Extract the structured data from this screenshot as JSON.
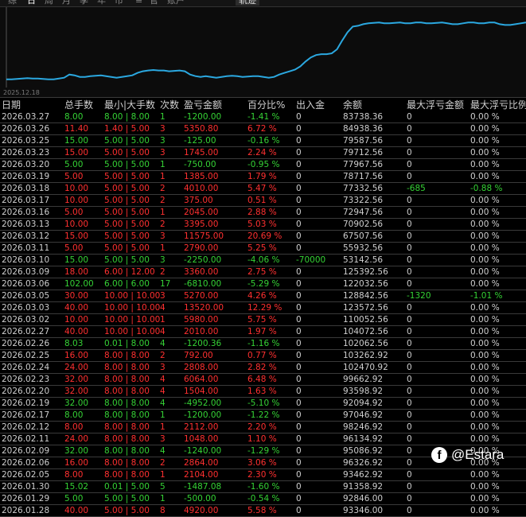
{
  "tabs": [
    {
      "label": "综",
      "active": false
    },
    {
      "label": "日",
      "active": true
    },
    {
      "label": "周",
      "active": false
    },
    {
      "label": "月",
      "active": false
    },
    {
      "label": "季",
      "active": false
    },
    {
      "label": "年",
      "active": false
    },
    {
      "label": "币",
      "active": false
    },
    {
      "label": "≡",
      "active": false
    },
    {
      "label": "官",
      "active": false
    },
    {
      "label": "账户",
      "active": false
    },
    {
      "label": "轨迹",
      "active": false,
      "boxed": true
    }
  ],
  "chart_data": {
    "type": "line",
    "x_start_label": "2025.12.18",
    "values": [
      10,
      10,
      10.5,
      11,
      11.5,
      11,
      11,
      10.5,
      10,
      10,
      11,
      12,
      16,
      15,
      13,
      13,
      14,
      14.5,
      15,
      14,
      13,
      12,
      13,
      14,
      15,
      18,
      20,
      21,
      21.5,
      21,
      21,
      20,
      20.5,
      21,
      20,
      16,
      14,
      13,
      14,
      13,
      12,
      13,
      14,
      14.5,
      14,
      13,
      13.5,
      14,
      14,
      13,
      12,
      13,
      16,
      18,
      20,
      22,
      26,
      32,
      37,
      40,
      41,
      41,
      42,
      47,
      58,
      68,
      75,
      76,
      78,
      79,
      79.5,
      80,
      79,
      79,
      79.5,
      80,
      79,
      79,
      80,
      80,
      79,
      79,
      79.5,
      80,
      79,
      78,
      78,
      79,
      80,
      80,
      79,
      79,
      80,
      80,
      78,
      77,
      77,
      78,
      79,
      80
    ],
    "ylim": [
      0,
      95
    ],
    "color": "#2ba8e0",
    "grid": false
  },
  "table": {
    "headers": [
      "日期",
      "总手数",
      "最小|大手数",
      "次数",
      "盈亏金额",
      "百分比%",
      "出入金",
      "余额",
      "最大浮亏金额",
      "最大浮亏比例"
    ],
    "rows": [
      {
        "date": "2026.03.27",
        "lots": "8.00",
        "minmax": "8.00 | 8.00",
        "count": "1",
        "pnl": "-1200.00",
        "pct": "-1.41 %",
        "flow": "0",
        "balance": "83738.36",
        "maxdd": "0",
        "maxddpct": "0.00 %",
        "sign": "pos"
      },
      {
        "date": "2026.03.26",
        "lots": "11.40",
        "minmax": "1.40 | 5.00",
        "count": "3",
        "pnl": "5350.80",
        "pct": "6.72 %",
        "flow": "0",
        "balance": "84938.36",
        "maxdd": "0",
        "maxddpct": "0.00 %",
        "sign": "neg"
      },
      {
        "date": "2026.03.25",
        "lots": "15.00",
        "minmax": "5.00 | 5.00",
        "count": "3",
        "pnl": "-125.00",
        "pct": "-0.16 %",
        "flow": "0",
        "balance": "79587.56",
        "maxdd": "0",
        "maxddpct": "0.00 %",
        "sign": "pos"
      },
      {
        "date": "2026.03.23",
        "lots": "15.00",
        "minmax": "5.00 | 5.00",
        "count": "3",
        "pnl": "1745.00",
        "pct": "2.24 %",
        "flow": "0",
        "balance": "79712.56",
        "maxdd": "0",
        "maxddpct": "0.00 %",
        "sign": "neg"
      },
      {
        "date": "2026.03.20",
        "lots": "5.00",
        "minmax": "5.00 | 5.00",
        "count": "1",
        "pnl": "-750.00",
        "pct": "-0.95 %",
        "flow": "0",
        "balance": "77967.56",
        "maxdd": "0",
        "maxddpct": "0.00 %",
        "sign": "pos"
      },
      {
        "date": "2026.03.19",
        "lots": "5.00",
        "minmax": "5.00 | 5.00",
        "count": "1",
        "pnl": "1385.00",
        "pct": "1.79 %",
        "flow": "0",
        "balance": "78717.56",
        "maxdd": "0",
        "maxddpct": "0.00 %",
        "sign": "neg"
      },
      {
        "date": "2026.03.18",
        "lots": "10.00",
        "minmax": "5.00 | 5.00",
        "count": "2",
        "pnl": "4010.00",
        "pct": "5.47 %",
        "flow": "0",
        "balance": "77332.56",
        "maxdd": "-685",
        "maxddpct": "-0.88 %",
        "sign": "neg",
        "ddsign": "pos"
      },
      {
        "date": "2026.03.17",
        "lots": "10.00",
        "minmax": "5.00 | 5.00",
        "count": "2",
        "pnl": "375.00",
        "pct": "0.51 %",
        "flow": "0",
        "balance": "73322.56",
        "maxdd": "0",
        "maxddpct": "0.00 %",
        "sign": "neg"
      },
      {
        "date": "2026.03.16",
        "lots": "5.00",
        "minmax": "5.00 | 5.00",
        "count": "1",
        "pnl": "2045.00",
        "pct": "2.88 %",
        "flow": "0",
        "balance": "72947.56",
        "maxdd": "0",
        "maxddpct": "0.00 %",
        "sign": "neg"
      },
      {
        "date": "2026.03.13",
        "lots": "10.00",
        "minmax": "5.00 | 5.00",
        "count": "2",
        "pnl": "3395.00",
        "pct": "5.03 %",
        "flow": "0",
        "balance": "70902.56",
        "maxdd": "0",
        "maxddpct": "0.00 %",
        "sign": "neg"
      },
      {
        "date": "2026.03.12",
        "lots": "15.00",
        "minmax": "5.00 | 5.00",
        "count": "3",
        "pnl": "11575.00",
        "pct": "20.69 %",
        "flow": "0",
        "balance": "67507.56",
        "maxdd": "0",
        "maxddpct": "0.00 %",
        "sign": "neg"
      },
      {
        "date": "2026.03.11",
        "lots": "5.00",
        "minmax": "5.00 | 5.00",
        "count": "1",
        "pnl": "2790.00",
        "pct": "5.25 %",
        "flow": "0",
        "balance": "55932.56",
        "maxdd": "0",
        "maxddpct": "0.00 %",
        "sign": "neg"
      },
      {
        "date": "2026.03.10",
        "lots": "15.00",
        "minmax": "5.00 | 5.00",
        "count": "3",
        "pnl": "-2250.00",
        "pct": "-4.06 %",
        "flow": "-70000",
        "balance": "53142.56",
        "maxdd": "0",
        "maxddpct": "0.00 %",
        "sign": "pos",
        "flowsign": "pos"
      },
      {
        "date": "2026.03.09",
        "lots": "18.00",
        "minmax": "6.00 | 12.00",
        "count": "2",
        "pnl": "3360.00",
        "pct": "2.75 %",
        "flow": "0",
        "balance": "125392.56",
        "maxdd": "0",
        "maxddpct": "0.00 %",
        "sign": "neg"
      },
      {
        "date": "2026.03.06",
        "lots": "102.00",
        "minmax": "6.00 | 6.00",
        "count": "17",
        "pnl": "-6810.00",
        "pct": "-5.29 %",
        "flow": "0",
        "balance": "122032.56",
        "maxdd": "0",
        "maxddpct": "0.00 %",
        "sign": "pos"
      },
      {
        "date": "2026.03.05",
        "lots": "30.00",
        "minmax": "10.00 | 10.00",
        "count": "3",
        "pnl": "5270.00",
        "pct": "4.26 %",
        "flow": "0",
        "balance": "128842.56",
        "maxdd": "-1320",
        "maxddpct": "-1.01 %",
        "sign": "neg",
        "ddsign": "pos"
      },
      {
        "date": "2026.03.03",
        "lots": "40.00",
        "minmax": "10.00 | 10.00",
        "count": "4",
        "pnl": "13520.00",
        "pct": "12.29 %",
        "flow": "0",
        "balance": "123572.56",
        "maxdd": "0",
        "maxddpct": "0.00 %",
        "sign": "neg"
      },
      {
        "date": "2026.03.02",
        "lots": "10.00",
        "minmax": "10.00 | 10.00",
        "count": "1",
        "pnl": "5980.00",
        "pct": "5.75 %",
        "flow": "0",
        "balance": "110052.56",
        "maxdd": "0",
        "maxddpct": "0.00 %",
        "sign": "neg"
      },
      {
        "date": "2026.02.27",
        "lots": "40.00",
        "minmax": "10.00 | 10.00",
        "count": "4",
        "pnl": "2010.00",
        "pct": "1.97 %",
        "flow": "0",
        "balance": "104072.56",
        "maxdd": "0",
        "maxddpct": "0.00 %",
        "sign": "neg"
      },
      {
        "date": "2026.02.26",
        "lots": "8.03",
        "minmax": "0.01 | 8.00",
        "count": "4",
        "pnl": "-1200.36",
        "pct": "-1.16 %",
        "flow": "0",
        "balance": "102062.56",
        "maxdd": "0",
        "maxddpct": "0.00 %",
        "sign": "pos"
      },
      {
        "date": "2026.02.25",
        "lots": "16.00",
        "minmax": "8.00 | 8.00",
        "count": "2",
        "pnl": "792.00",
        "pct": "0.77 %",
        "flow": "0",
        "balance": "103262.92",
        "maxdd": "0",
        "maxddpct": "0.00 %",
        "sign": "neg"
      },
      {
        "date": "2026.02.24",
        "lots": "24.00",
        "minmax": "8.00 | 8.00",
        "count": "3",
        "pnl": "2808.00",
        "pct": "2.82 %",
        "flow": "0",
        "balance": "102470.92",
        "maxdd": "0",
        "maxddpct": "0.00 %",
        "sign": "neg"
      },
      {
        "date": "2026.02.23",
        "lots": "32.00",
        "minmax": "8.00 | 8.00",
        "count": "4",
        "pnl": "6064.00",
        "pct": "6.48 %",
        "flow": "0",
        "balance": "99662.92",
        "maxdd": "0",
        "maxddpct": "0.00 %",
        "sign": "neg"
      },
      {
        "date": "2026.02.20",
        "lots": "32.00",
        "minmax": "8.00 | 8.00",
        "count": "4",
        "pnl": "1504.00",
        "pct": "1.63 %",
        "flow": "0",
        "balance": "93598.92",
        "maxdd": "0",
        "maxddpct": "0.00 %",
        "sign": "neg"
      },
      {
        "date": "2026.02.19",
        "lots": "32.00",
        "minmax": "8.00 | 8.00",
        "count": "4",
        "pnl": "-4952.00",
        "pct": "-5.10 %",
        "flow": "0",
        "balance": "92094.92",
        "maxdd": "0",
        "maxddpct": "0.00 %",
        "sign": "pos"
      },
      {
        "date": "2026.02.17",
        "lots": "8.00",
        "minmax": "8.00 | 8.00",
        "count": "1",
        "pnl": "-1200.00",
        "pct": "-1.22 %",
        "flow": "0",
        "balance": "97046.92",
        "maxdd": "0",
        "maxddpct": "0.00 %",
        "sign": "pos"
      },
      {
        "date": "2026.02.12",
        "lots": "8.00",
        "minmax": "8.00 | 8.00",
        "count": "1",
        "pnl": "2112.00",
        "pct": "2.20 %",
        "flow": "0",
        "balance": "98246.92",
        "maxdd": "0",
        "maxddpct": "0.00 %",
        "sign": "neg"
      },
      {
        "date": "2026.02.11",
        "lots": "24.00",
        "minmax": "8.00 | 8.00",
        "count": "3",
        "pnl": "1048.00",
        "pct": "1.10 %",
        "flow": "0",
        "balance": "96134.92",
        "maxdd": "0",
        "maxddpct": "0.00 %",
        "sign": "neg"
      },
      {
        "date": "2026.02.09",
        "lots": "32.00",
        "minmax": "8.00 | 8.00",
        "count": "4",
        "pnl": "-1240.00",
        "pct": "-1.29 %",
        "flow": "0",
        "balance": "95086.92",
        "maxdd": "0",
        "maxddpct": "0.00 %",
        "sign": "pos"
      },
      {
        "date": "2026.02.06",
        "lots": "16.00",
        "minmax": "8.00 | 8.00",
        "count": "2",
        "pnl": "2864.00",
        "pct": "3.06 %",
        "flow": "0",
        "balance": "96326.92",
        "maxdd": "0",
        "maxddpct": "0.00 %",
        "sign": "neg"
      },
      {
        "date": "2026.02.05",
        "lots": "8.00",
        "minmax": "8.00 | 8.00",
        "count": "1",
        "pnl": "2104.00",
        "pct": "2.30 %",
        "flow": "0",
        "balance": "93462.92",
        "maxdd": "0",
        "maxddpct": "0.00 %",
        "sign": "neg"
      },
      {
        "date": "2026.01.30",
        "lots": "15.02",
        "minmax": "0.01 | 5.00",
        "count": "5",
        "pnl": "-1487.08",
        "pct": "-1.60 %",
        "flow": "0",
        "balance": "91358.92",
        "maxdd": "0",
        "maxddpct": "0.00 %",
        "sign": "pos"
      },
      {
        "date": "2026.01.29",
        "lots": "5.00",
        "minmax": "5.00 | 5.00",
        "count": "1",
        "pnl": "-500.00",
        "pct": "-0.54 %",
        "flow": "0",
        "balance": "92846.00",
        "maxdd": "0",
        "maxddpct": "0.00 %",
        "sign": "pos"
      },
      {
        "date": "2026.01.28",
        "lots": "40.00",
        "minmax": "5.00 | 5.00",
        "count": "8",
        "pnl": "4920.00",
        "pct": "5.58 %",
        "flow": "0",
        "balance": "93346.00",
        "maxdd": "0",
        "maxddpct": "0.00 %",
        "sign": "neg"
      }
    ]
  },
  "watermark": {
    "icon": "facebook-icon",
    "text": "@Estara"
  }
}
